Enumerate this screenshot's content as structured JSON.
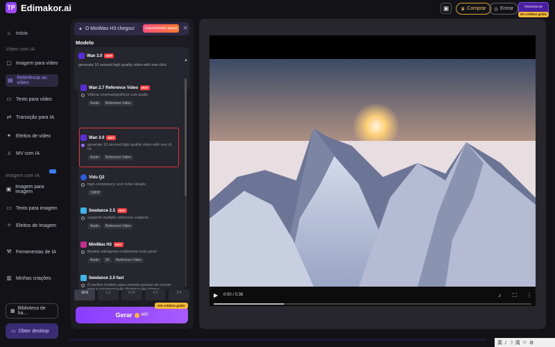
{
  "brand": {
    "name": "Edimakor.ai",
    "mark": "TP"
  },
  "topbar": {
    "buy_label": "Comprar",
    "login_label": "Entrar",
    "signup_label": "Inscreva-se",
    "credits_badge": "5K créditos grátis"
  },
  "sidebar": {
    "home": "Início",
    "section_video": "Vídeo com IA",
    "items_video": [
      "Imagem para vídeo",
      "Referência ao vídeo",
      "Texto para vídeo",
      "Transição para IA",
      "Efeitos de vídeo",
      "MV com IA"
    ],
    "section_image": "Imagem com IA",
    "items_image": [
      "Imagem para imagem",
      "Texto para imagem",
      "Efeitos de imagem"
    ],
    "tools": "Ferramentas de IA",
    "creations": "Minhas criações",
    "library": "Biblioteca de ha...",
    "desktop": "Obter desktop"
  },
  "panel": {
    "promo_text": "O MiniMax H3 chegou!",
    "promo_button": "Experimente agora",
    "modelo_label": "Modelo",
    "selected": {
      "name": "Wan 3.0",
      "badge": "HOT",
      "desc": "generate 10 second high quality video with one click"
    },
    "models": [
      {
        "name": "Wan 2.7 Reference Video",
        "badge": "HOT",
        "desc": "Vídeos cinematográficos com áudio",
        "tags": [
          "Áudio",
          "Reference Video"
        ]
      },
      {
        "name": "Wan 3.0",
        "badge": "HOT",
        "desc": "generate 10 second high quality video with one cli ck",
        "tags": [
          "Áudio",
          "Reference Video"
        ]
      },
      {
        "name": "Vidu Q2",
        "badge": "",
        "desc": "high consistency and richer details",
        "tags": [
          "1080P"
        ]
      },
      {
        "name": "Seedance 2.5",
        "badge": "HOT",
        "desc": "supports multiple reference subjects",
        "tags": [
          "Áudio",
          "Reference Video"
        ]
      },
      {
        "name": "MiniMax H3",
        "badge": "HOT",
        "desc": "Modelo inteligente multimodal mais geral",
        "tags": [
          "Áudio",
          "2K",
          "Reference Video"
        ]
      },
      {
        "name": "Seedance 2.0 fast",
        "badge": "",
        "desc": "O melhor modelo para controle preciso do movim ento e movimentação dinâmica da câmera.",
        "tags": [
          "Áudio"
        ]
      }
    ],
    "ratios": [
      "16:9",
      "1:1",
      "9:16",
      "4:3",
      "3:4"
    ],
    "free_badge": "Até créditos grátis",
    "generate_label": "Gerar",
    "generate_cost": "400"
  },
  "player": {
    "time": "0:00 / 0:36",
    "progress": 0.22
  },
  "taskbar": [
    "英",
    "ﾉ",
    "☽",
    "简",
    "☺",
    "⚙"
  ]
}
